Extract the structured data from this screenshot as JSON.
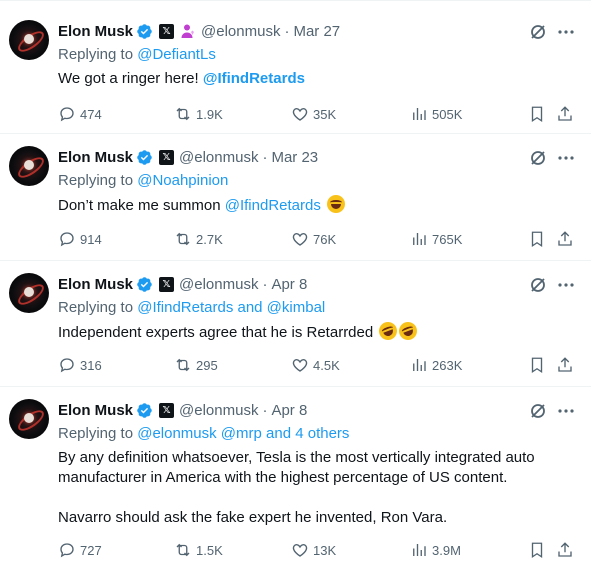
{
  "tweets": [
    {
      "author": "Elon Musk",
      "handle": "@elonmusk",
      "time": "Mar 27",
      "reply_prefix": "Replying to",
      "reply_to": "@DefiantLs",
      "text_plain": "We got a ringer here! ",
      "text_mention": "@IfindRetards",
      "replies": "474",
      "reposts": "1.9K",
      "likes": "35K",
      "views": "505K",
      "has_affiliate_badge": true
    },
    {
      "author": "Elon Musk",
      "handle": "@elonmusk",
      "time": "Mar 23",
      "reply_prefix": "Replying to",
      "reply_to": "@Noahpinion",
      "text_plain": "Don’t make me summon ",
      "text_mention": "@IfindRetards",
      "replies": "914",
      "reposts": "2.7K",
      "likes": "76K",
      "views": "765K",
      "emoji": "laughing-tears-emoji"
    },
    {
      "author": "Elon Musk",
      "handle": "@elonmusk",
      "time": "Apr 8",
      "reply_prefix": "Replying to",
      "reply_to": "@IfindRetards and @kimbal",
      "text_plain": "Independent experts agree that he is Retarrded ",
      "replies": "316",
      "reposts": "295",
      "likes": "4.5K",
      "views": "263K",
      "emoji": "rofl-emoji"
    },
    {
      "author": "Elon Musk",
      "handle": "@elonmusk",
      "time": "Apr 8",
      "reply_prefix": "Replying to",
      "reply_to": "@elonmusk @mrp and 4 others",
      "text_line1": "By any definition whatsoever, Tesla is the most vertically integrated auto",
      "text_line2": "manufacturer in America with the highest percentage of US content.",
      "text_line3": "Navarro should ask the fake expert he invented, Ron Vara.",
      "replies": "727",
      "reposts": "1.5K",
      "likes": "13K",
      "views": "3.9M"
    }
  ],
  "colors": {
    "accent": "#1d9bf0",
    "muted": "#536471",
    "text": "#0f1419"
  },
  "icons": [
    "verified-badge-icon",
    "x-affiliate-icon",
    "grok-icon",
    "more-icon",
    "reply-icon",
    "repost-icon",
    "like-icon",
    "views-icon",
    "bookmark-icon",
    "share-icon"
  ]
}
